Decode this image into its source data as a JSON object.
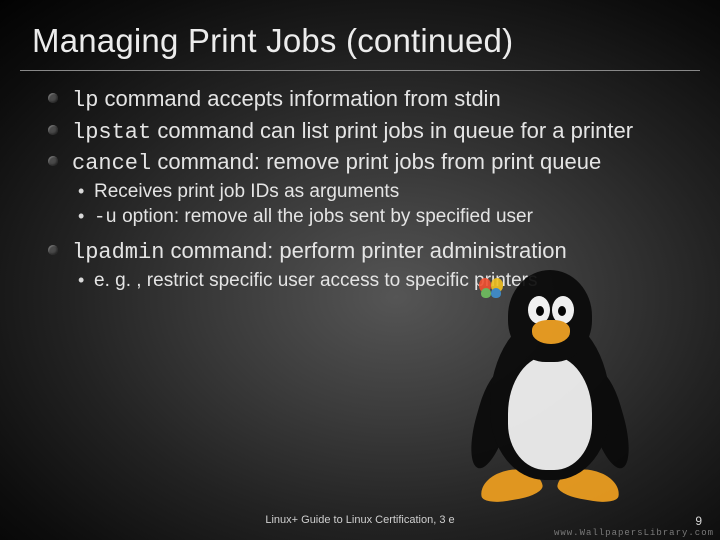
{
  "title": "Managing Print Jobs (continued)",
  "bullets": {
    "b1": {
      "cmd": "lp",
      "rest": " command accepts information from stdin"
    },
    "b2": {
      "cmd": "lpstat",
      "rest": " command can list print jobs in queue for a printer"
    },
    "b3": {
      "cmd": "cancel",
      "rest": " command: remove print jobs from print queue",
      "sub": {
        "s1": "Receives print job IDs as arguments",
        "s2": {
          "cmd": "-u",
          "rest": " option: remove all the jobs sent by specified user"
        }
      }
    },
    "b4": {
      "cmd": "lpadmin",
      "rest": " command: perform printer administration",
      "sub": {
        "s1": "e. g. , restrict specific user access to specific printers"
      }
    }
  },
  "footer": "Linux+ Guide to Linux Certification, 3 e",
  "pagenum": "9",
  "watermark": "www.WallpapersLibrary.com"
}
